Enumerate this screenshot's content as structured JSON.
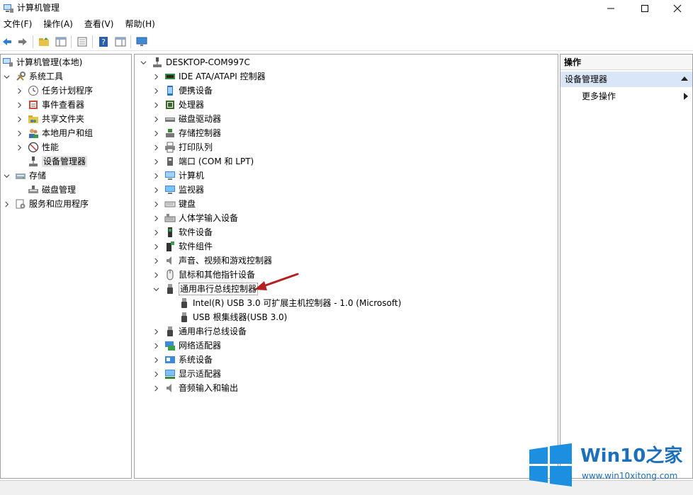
{
  "window": {
    "title": "计算机管理",
    "controls": [
      "minimize-icon",
      "maximize-icon",
      "close-icon"
    ]
  },
  "menu": [
    "文件(F)",
    "操作(A)",
    "查看(V)",
    "帮助(H)"
  ],
  "toolbar": {
    "icons": [
      "back-arrow-icon",
      "forward-arrow-icon",
      "up-folder-icon",
      "show-hide-console-tree-icon",
      "properties-icon",
      "help-icon",
      "action-pane-icon",
      "monitor-icon"
    ]
  },
  "left_tree": [
    {
      "label": "计算机管理(本地)",
      "icon": "computer-management-icon"
    },
    {
      "label": "系统工具",
      "icon": "tools-icon"
    },
    {
      "label": "任务计划程序",
      "icon": "clock-icon"
    },
    {
      "label": "事件查看器",
      "icon": "event-viewer-icon"
    },
    {
      "label": "共享文件夹",
      "icon": "shared-folder-icon"
    },
    {
      "label": "本地用户和组",
      "icon": "users-icon"
    },
    {
      "label": "性能",
      "icon": "performance-icon"
    },
    {
      "label": "设备管理器",
      "icon": "device-manager-icon"
    },
    {
      "label": "存储",
      "icon": "storage-icon"
    },
    {
      "label": "磁盘管理",
      "icon": "disk-management-icon"
    },
    {
      "label": "服务和应用程序",
      "icon": "services-icon"
    }
  ],
  "device_tree": {
    "root": "DESKTOP-COM997C",
    "categories": [
      {
        "label": "IDE ATA/ATAPI 控制器",
        "icon": "ide-controller-icon"
      },
      {
        "label": "便携设备",
        "icon": "portable-device-icon"
      },
      {
        "label": "处理器",
        "icon": "processor-icon"
      },
      {
        "label": "磁盘驱动器",
        "icon": "disk-drive-icon"
      },
      {
        "label": "存储控制器",
        "icon": "storage-controller-icon"
      },
      {
        "label": "打印队列",
        "icon": "printer-icon"
      },
      {
        "label": "端口 (COM 和 LPT)",
        "icon": "port-icon"
      },
      {
        "label": "计算机",
        "icon": "computer-icon"
      },
      {
        "label": "监视器",
        "icon": "monitor-icon"
      },
      {
        "label": "键盘",
        "icon": "keyboard-icon"
      },
      {
        "label": "人体学输入设备",
        "icon": "hid-icon"
      },
      {
        "label": "软件设备",
        "icon": "software-device-icon"
      },
      {
        "label": "软件组件",
        "icon": "software-component-icon"
      },
      {
        "label": "声音、视频和游戏控制器",
        "icon": "speaker-icon"
      },
      {
        "label": "鼠标和其他指针设备",
        "icon": "mouse-icon"
      },
      {
        "label": "通用串行总线控制器",
        "icon": "usb-icon"
      },
      {
        "label": "Intel(R) USB 3.0 可扩展主机控制器 - 1.0 (Microsoft)",
        "icon": "usb-icon"
      },
      {
        "label": "USB 根集线器(USB 3.0)",
        "icon": "usb-icon"
      },
      {
        "label": "通用串行总线设备",
        "icon": "usb-icon"
      },
      {
        "label": "网络适配器",
        "icon": "network-adapter-icon"
      },
      {
        "label": "系统设备",
        "icon": "system-device-icon"
      },
      {
        "label": "显示适配器",
        "icon": "display-adapter-icon"
      },
      {
        "label": "音频输入和输出",
        "icon": "audio-icon"
      }
    ]
  },
  "actions_pane": {
    "header": "操作",
    "section": "设备管理器",
    "more": "更多操作"
  },
  "watermark": {
    "title_main": "Win10",
    "title_accent": "之家",
    "url": "www.win10xitong.com"
  },
  "colors": {
    "annotation_arrow": "#b22222",
    "selection": "#e5e5e5",
    "actions_section_bg": "#d9e6f7",
    "watermark_blue": "#1c6fb8"
  }
}
